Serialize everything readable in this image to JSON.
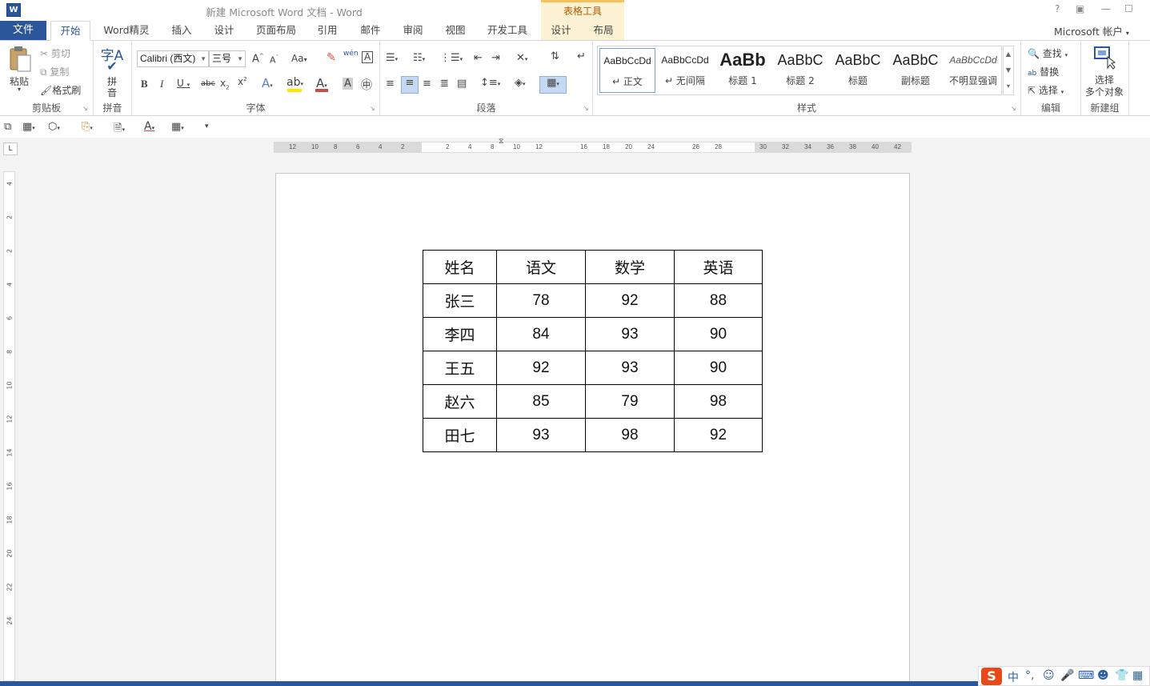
{
  "app": {
    "title": "新建 Microsoft Word 文档 - Word",
    "logo": "W",
    "contextual_label": "表格工具",
    "help": "?",
    "account": "Microsoft 帐户"
  },
  "tabs": {
    "file": "文件",
    "items": [
      "开始",
      "Word精灵",
      "插入",
      "设计",
      "页面布局",
      "引用",
      "邮件",
      "审阅",
      "视图",
      "开发工具",
      "设计",
      "布局"
    ]
  },
  "ribbon": {
    "clipboard": {
      "paste": "粘贴",
      "cut": "剪切",
      "copy": "复制",
      "format_painter": "格式刷",
      "label": "剪贴板"
    },
    "pinyin": {
      "button_top": "拼",
      "button_bottom": "音",
      "label": "拼音",
      "glyph": "字A"
    },
    "font": {
      "name": "Calibri (西文)",
      "size": "三号",
      "label": "字体",
      "wen": "wén",
      "font_color": "#c0504d",
      "highlight_color": "#ffe600"
    },
    "paragraph": {
      "label": "段落"
    },
    "styles": {
      "label": "样式",
      "items": [
        {
          "preview": "AaBbCcDd",
          "name": "正文"
        },
        {
          "preview": "AaBbCcDd",
          "name": "无间隔"
        },
        {
          "preview": "AaBb",
          "name": "标题 1"
        },
        {
          "preview": "AaBbC",
          "name": "标题 2"
        },
        {
          "preview": "AaBbC",
          "name": "标题"
        },
        {
          "preview": "AaBbC",
          "name": "副标题"
        },
        {
          "preview": "AaBbCcDd",
          "name": "不明显强调"
        }
      ]
    },
    "editing": {
      "find": "查找",
      "replace": "替换",
      "select": "选择",
      "label": "编辑"
    },
    "newgroup": {
      "select_line1": "选择",
      "select_line2": "多个对象",
      "label": "新建组"
    }
  },
  "ruler": {
    "h_ticks": [
      "12",
      "10",
      "8",
      "6",
      "4",
      "2",
      "2",
      "4",
      "8",
      "10",
      "12",
      "16",
      "18",
      "20",
      "24",
      "26",
      "28",
      "30",
      "32",
      "34",
      "36",
      "38",
      "40",
      "42"
    ],
    "v_ticks": [
      "4",
      "2",
      "2",
      "4",
      "6",
      "8",
      "10",
      "12",
      "14",
      "16",
      "18",
      "20",
      "22",
      "24"
    ]
  },
  "table": {
    "headers": [
      "姓名",
      "语文",
      "数学",
      "英语"
    ],
    "rows": [
      [
        "张三",
        "78",
        "92",
        "88"
      ],
      [
        "李四",
        "84",
        "93",
        "90"
      ],
      [
        "王五",
        "92",
        "93",
        "90"
      ],
      [
        "赵六",
        "85",
        "79",
        "98"
      ],
      [
        "田七",
        "93",
        "98",
        "92"
      ]
    ]
  },
  "ime": {
    "logo": "S",
    "mode": "中",
    "punct": "°,"
  },
  "colors": {
    "accent": "#2b579a",
    "tools_band": "#fbf1d3",
    "tools_text": "#b35b00"
  }
}
